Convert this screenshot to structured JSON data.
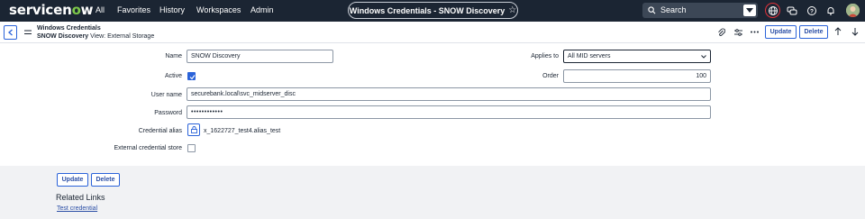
{
  "topnav": {
    "logo": "servicenow",
    "links": [
      "All",
      "Favorites",
      "History",
      "Workspaces",
      "Admin"
    ],
    "context_title": "Windows Credentials - SNOW Discovery",
    "search_placeholder": "Search"
  },
  "header": {
    "title": "Windows Credentials",
    "record": "SNOW Discovery",
    "view": "View: External Storage",
    "update_label": "Update",
    "delete_label": "Delete"
  },
  "form": {
    "name_label": "Name",
    "name_value": "SNOW Discovery",
    "active_label": "Active",
    "active_checked": true,
    "username_label": "User name",
    "username_value": "securebank.local\\svc_midserver_disc",
    "password_label": "Password",
    "password_value": "••••••••••••",
    "alias_label": "Credential alias",
    "alias_value": "x_1622727_test4.alias_test",
    "external_label": "External credential store",
    "external_checked": false,
    "applies_label": "Applies to",
    "applies_value": "All MID servers",
    "order_label": "Order",
    "order_value": "100"
  },
  "footer": {
    "update_label": "Update",
    "delete_label": "Delete",
    "related_title": "Related Links",
    "test_link": "Test credential"
  },
  "colors": {
    "nav_bg": "#1b2533",
    "accent": "#2b63d9",
    "logo_green": "#7ec94a",
    "highlight_ring": "#e0323a"
  }
}
